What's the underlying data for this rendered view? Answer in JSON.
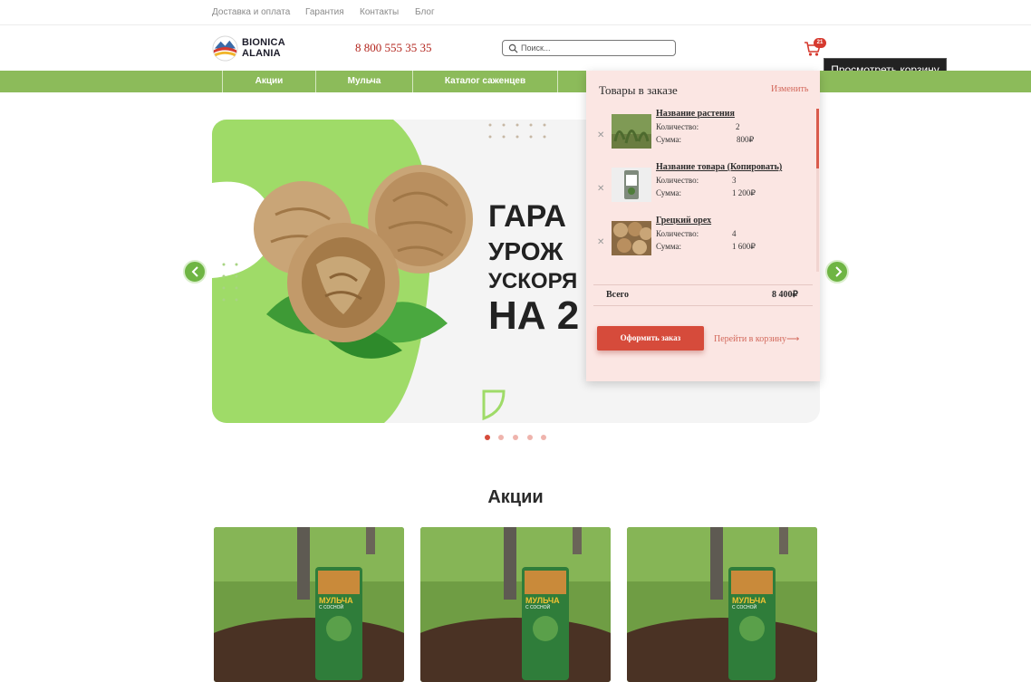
{
  "top_links": [
    "Доставка и оплата",
    "Гарантия",
    "Контакты",
    "Блог"
  ],
  "header": {
    "logo_line1": "BIONICA",
    "logo_line2": "ALANIA",
    "phone": "8 800 555 35 35",
    "search_placeholder": "Поиск...",
    "cart_count": "21",
    "cart_icon": "cart-icon",
    "tooltip": "Просмотреть корзину"
  },
  "nav": [
    "Акции",
    "Мульча",
    "Каталог саженцев"
  ],
  "slider": {
    "lines": [
      "ГАРА",
      "УРОЖ",
      "УСКОРЯ",
      "НА 2"
    ],
    "slide_count": 5,
    "active_slide": 1
  },
  "cart_panel": {
    "title": "Товары в заказе",
    "edit_label": "Изменить",
    "items": [
      {
        "name": "Название растения",
        "qty_label": "Количество:",
        "qty": "2",
        "sum_label": "Сумма:",
        "sum": "800₽"
      },
      {
        "name": "Название товара (Копировать)",
        "qty_label": "Количество:",
        "qty": "3",
        "sum_label": "Сумма:",
        "sum": "1 200₽"
      },
      {
        "name": "Грецкий орех",
        "qty_label": "Количество:",
        "qty": "4",
        "sum_label": "Сумма:",
        "sum": "1 600₽"
      }
    ],
    "total_label": "Всего",
    "total_value": "8 400₽",
    "checkout_label": "Оформить заказ",
    "go_cart_label": "Перейти в корзину⟶"
  },
  "promo_section": {
    "title": "Акции",
    "cards": [
      {
        "pack_line1": "МУЛЬЧА",
        "pack_line2": "С СОСНОЙ"
      },
      {
        "pack_line1": "МУЛЬЧА",
        "pack_line2": "С СОСНОЙ"
      },
      {
        "pack_line1": "МУЛЬЧА",
        "pack_line2": "С СОСНОЙ"
      }
    ]
  },
  "colors": {
    "accent": "#8cbb5a",
    "brand_red": "#d64b3b",
    "panel_bg": "#fbe6e3"
  }
}
